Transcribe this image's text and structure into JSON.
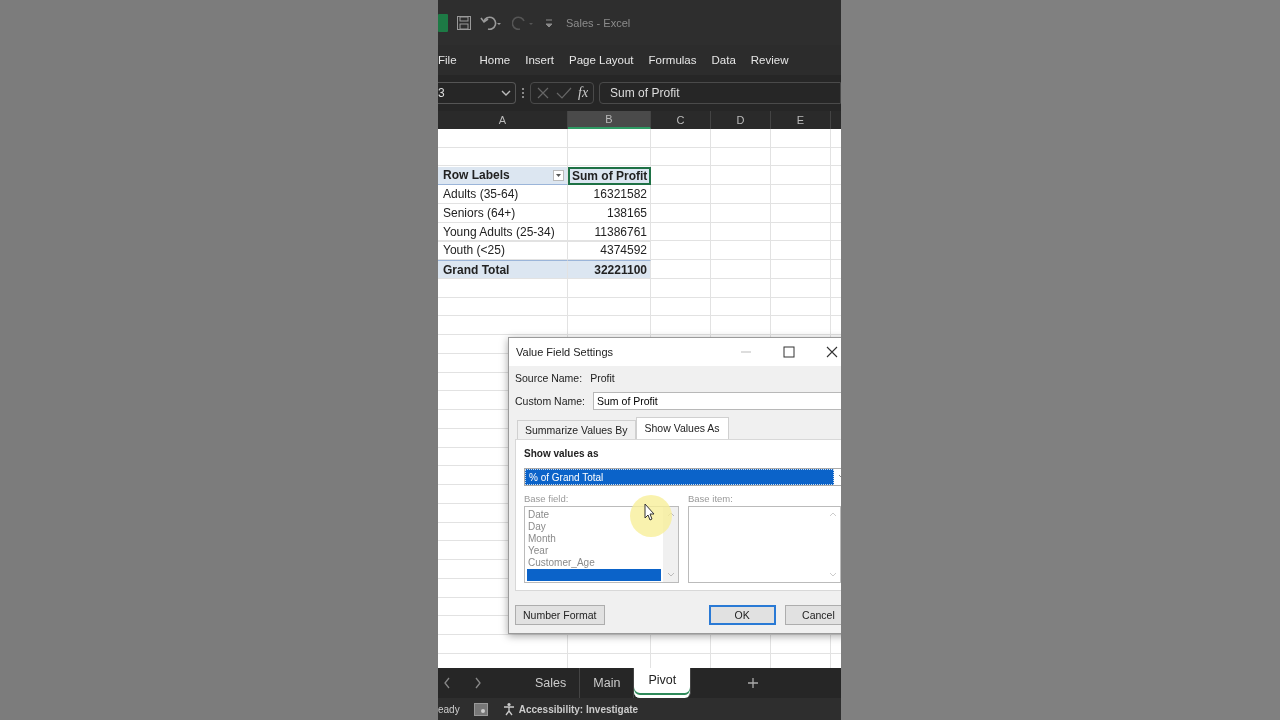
{
  "title_bar": {
    "title": "Sales - Excel"
  },
  "ribbon_tabs": [
    "File",
    "Home",
    "Insert",
    "Page Layout",
    "Formulas",
    "Data",
    "Review"
  ],
  "formula_bar": {
    "name_box": "3",
    "fx": "fx",
    "content": "Sum of Profit"
  },
  "columns": [
    {
      "label": "A",
      "selected": false
    },
    {
      "label": "B",
      "selected": true
    },
    {
      "label": "C",
      "selected": false
    },
    {
      "label": "D",
      "selected": false
    },
    {
      "label": "E",
      "selected": false
    }
  ],
  "pivot": {
    "header": [
      "Row Labels",
      "Sum of Profit"
    ],
    "rows": [
      {
        "label": "Adults (35-64)",
        "value": "16321582"
      },
      {
        "label": "Seniors (64+)",
        "value": "138165"
      },
      {
        "label": "Young Adults (25-34)",
        "value": "11386761"
      },
      {
        "label": "Youth (<25)",
        "value": "4374592"
      }
    ],
    "total": {
      "label": "Grand Total",
      "value": "32221100"
    }
  },
  "dialog": {
    "title": "Value Field Settings",
    "source_label": "Source Name:",
    "source_value": "Profit",
    "custom_label": "Custom Name:",
    "custom_value": "Sum of Profit",
    "tabs": [
      {
        "label": "Summarize Values By",
        "selected": false
      },
      {
        "label": "Show Values As",
        "selected": true
      }
    ],
    "show_values_label": "Show values as",
    "show_values_value": "% of Grand Total",
    "base_field_label": "Base field:",
    "base_field_items": [
      {
        "label": "Date",
        "selected": false
      },
      {
        "label": "Day",
        "selected": false
      },
      {
        "label": "Month",
        "selected": false
      },
      {
        "label": "Year",
        "selected": false
      },
      {
        "label": "Customer_Age",
        "selected": false
      },
      {
        "selected": true
      }
    ],
    "base_item_label": "Base item:",
    "buttons": [
      {
        "label": "Number Format",
        "kind": "left"
      },
      {
        "label": "OK",
        "kind": "default"
      },
      {
        "label": "Cancel",
        "kind": "normal"
      }
    ]
  },
  "sheet_tabs": [
    {
      "label": "Sales",
      "selected": false
    },
    {
      "label": "Main",
      "selected": false
    },
    {
      "label": "Pivot",
      "selected": true
    }
  ],
  "status_bar": {
    "mode": "eady",
    "accessibility": "Accessibility: Investigate"
  }
}
